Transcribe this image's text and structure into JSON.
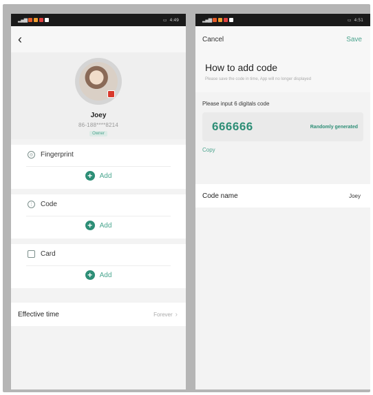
{
  "status_bar_left": {
    "time": "4:49"
  },
  "status_bar_right": {
    "time": "4:51"
  },
  "left_screen": {
    "profile": {
      "name": "Joey",
      "phone": "86-188****8214",
      "role": "Owner"
    },
    "credentials": [
      {
        "label": "Fingerprint",
        "icon": "fingerprint-icon",
        "add_label": "Add"
      },
      {
        "label": "Code",
        "icon": "code-icon",
        "add_label": "Add"
      },
      {
        "label": "Card",
        "icon": "card-icon",
        "add_label": "Add"
      }
    ],
    "effective_time": {
      "label": "Effective time",
      "value": "Forever"
    }
  },
  "right_screen": {
    "nav": {
      "cancel": "Cancel",
      "save": "Save"
    },
    "title": "How to add code",
    "subtitle": "Please save the code in time, App will no longer displayed",
    "input_label": "Please input 6 digitals code",
    "code": "666666",
    "random_label": "Randomly generated",
    "copy_label": "Copy",
    "code_name": {
      "label": "Code name",
      "value": "Joey"
    }
  },
  "colors": {
    "accent": "#2d8e76",
    "accent_light": "#4aa38d",
    "background": "#f3f3f3",
    "frame": "#b5b5b5"
  }
}
